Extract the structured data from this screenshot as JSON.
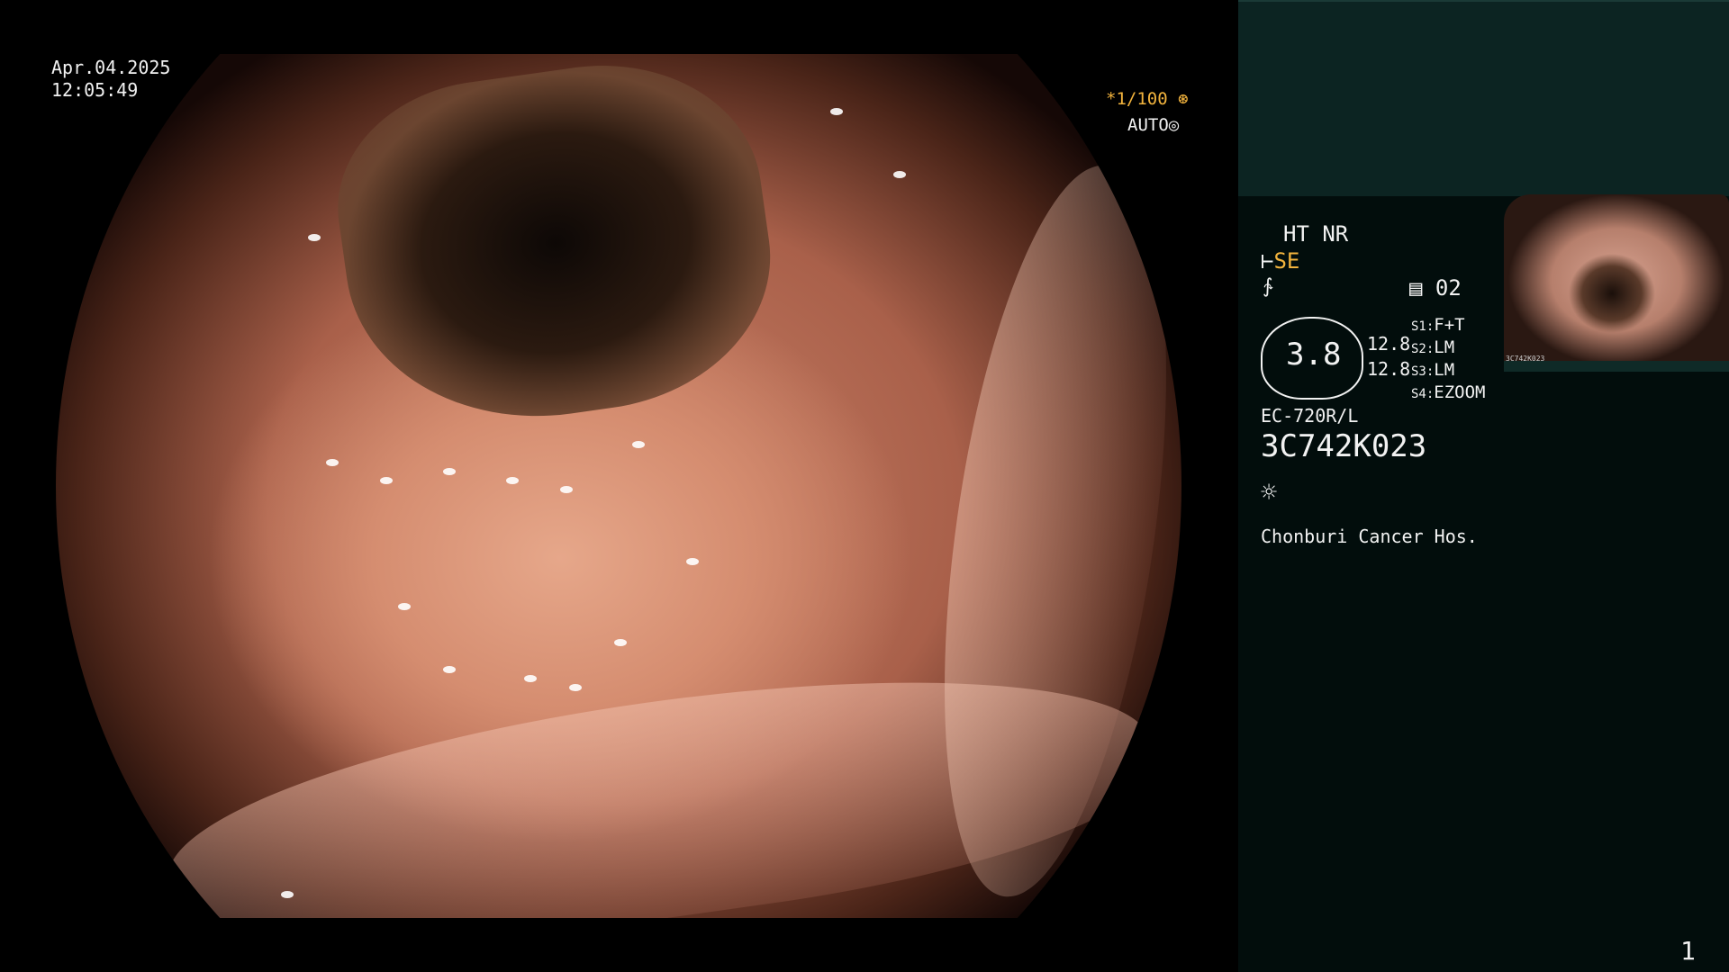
{
  "overlay": {
    "date": "Apr.04.2025",
    "time": "12:05:49",
    "shutter": "*1/100",
    "shutter_icon": "aperture-icon",
    "auto": "AUTO",
    "auto_icon": "iris-icon"
  },
  "panel": {
    "mode": "HT NR",
    "enhance_icon": "sharpen-icon",
    "enhance": "SE",
    "f_icon": "filter-icon",
    "memory_icon": "memory-icon",
    "memory_slot": "02",
    "gauge_value": "3.8",
    "gauge_a": "12.8",
    "gauge_b": "12.8",
    "s1_key": "S1:",
    "s1_val": "F+T",
    "s2_key": "S2:",
    "s2_val": "LM",
    "s3_key": "S3:",
    "s3_val": "LM",
    "s4_key": "S4:",
    "s4_val": "EZOOM",
    "model": "EC-720R/L",
    "serial": "3C742K023",
    "light_icon": "sun-icon",
    "hospital": "Chonburi Cancer Hos.",
    "page_number": "1",
    "thumb_caption": "3C742K023"
  },
  "colors": {
    "accent": "#f2b33d",
    "panel_bg": "#020d0c",
    "panel_top": "#0c2422"
  }
}
